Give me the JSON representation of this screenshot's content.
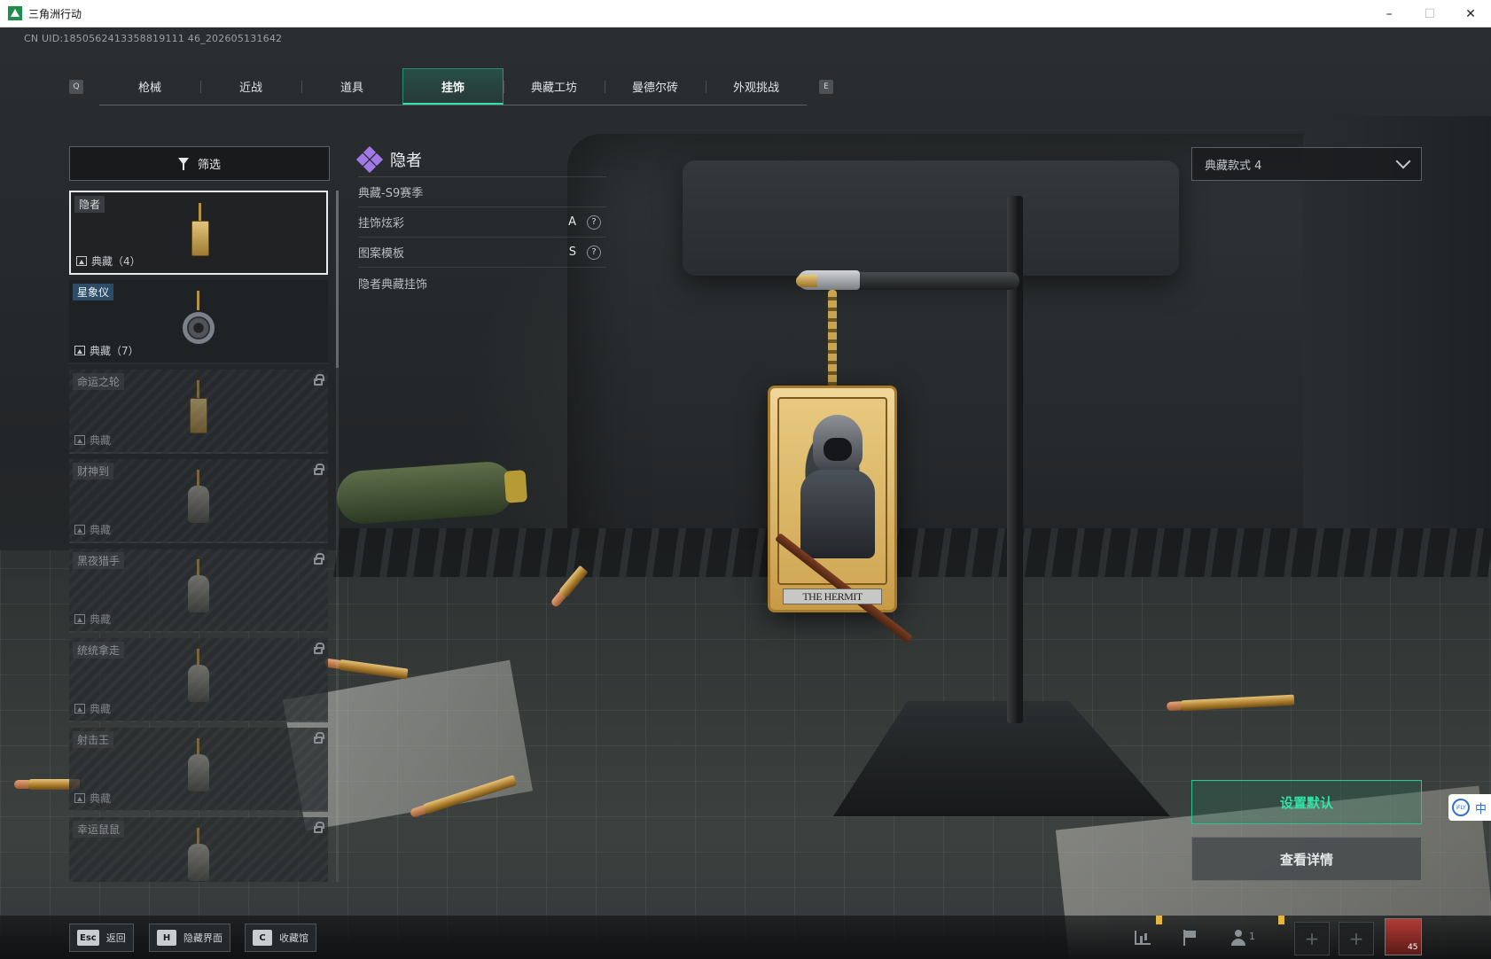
{
  "window": {
    "title": "三角洲行动",
    "controls": {
      "minimize": "–",
      "maximize": "☐",
      "close": "✕"
    }
  },
  "uid_text": "CN UID:1850562413358819111 46_202605131642",
  "tabs": {
    "left_key": "Q",
    "right_key": "E",
    "items": [
      {
        "label": "枪械",
        "active": false
      },
      {
        "label": "近战",
        "active": false
      },
      {
        "label": "道具",
        "active": false
      },
      {
        "label": "挂饰",
        "active": true
      },
      {
        "label": "典藏工坊",
        "active": false
      },
      {
        "label": "曼德尔砖",
        "active": false
      },
      {
        "label": "外观挑战",
        "active": false
      }
    ]
  },
  "filter": {
    "label": "筛选"
  },
  "list": {
    "items": [
      {
        "name": "隐者",
        "sub": "典藏（4）",
        "state": "selected"
      },
      {
        "name": "星象仪",
        "sub": "典藏（7）",
        "state": "owned"
      },
      {
        "name": "命运之轮",
        "sub": "典藏",
        "state": "locked"
      },
      {
        "name": "财神到",
        "sub": "典藏",
        "state": "locked"
      },
      {
        "name": "黑夜猎手",
        "sub": "典藏",
        "state": "locked"
      },
      {
        "name": "统统拿走",
        "sub": "典藏",
        "state": "locked"
      },
      {
        "name": "射击王",
        "sub": "典藏",
        "state": "locked"
      },
      {
        "name": "幸运鼠鼠",
        "sub": "",
        "state": "locked"
      }
    ]
  },
  "detail": {
    "title": "隐者",
    "season": "典藏-S9赛季",
    "rows": [
      {
        "label": "挂饰炫彩",
        "value": "A",
        "help": "?"
      },
      {
        "label": "图案模板",
        "value": "S",
        "help": "?"
      }
    ],
    "description": "隐者典藏挂饰"
  },
  "variant_select": {
    "value": "典藏款式 4"
  },
  "pendant_label": "THE HERMIT",
  "buttons": {
    "set_default": "设置默认",
    "view_details": "查看详情"
  },
  "ime": {
    "logo": "iFLY",
    "mode": "中"
  },
  "bottom_hotkeys": [
    {
      "key": "Esc",
      "label": "返回"
    },
    {
      "key": "H",
      "label": "隐藏界面"
    },
    {
      "key": "C",
      "label": "收藏馆"
    }
  ],
  "team": {
    "count": "1"
  },
  "avatar": {
    "level": "45"
  },
  "colors": {
    "accent": "#2fe0a8",
    "rarity": "#a27ae6",
    "warning": "#e3b73b"
  }
}
